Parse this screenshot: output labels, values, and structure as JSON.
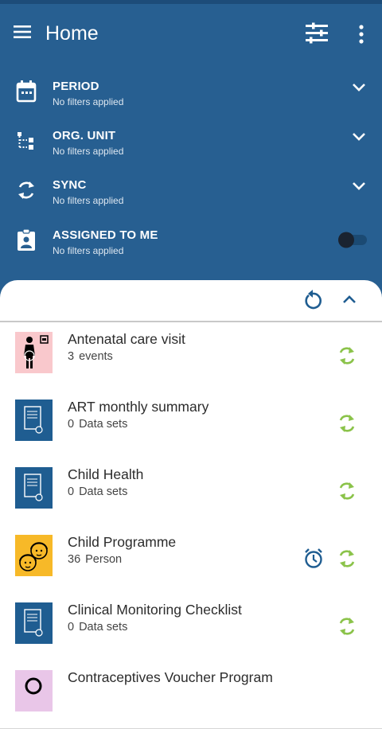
{
  "appbar": {
    "title": "Home",
    "menu_icon": "hamburger-icon",
    "filter_icon": "filter-list-icon",
    "more_icon": "more-vert-icon"
  },
  "filters": [
    {
      "icon": "calendar-icon",
      "label": "PERIOD",
      "sub": "No filters applied",
      "control": "chevron-down-icon"
    },
    {
      "icon": "org-tree-icon",
      "label": "ORG. UNIT",
      "sub": "No filters applied",
      "control": "chevron-down-icon"
    },
    {
      "icon": "sync-icon",
      "label": "SYNC",
      "sub": "No filters applied",
      "control": "chevron-down-icon"
    },
    {
      "icon": "assignment-ind-icon",
      "label": "ASSIGNED TO ME",
      "sub": "No filters applied",
      "control": "toggle",
      "toggle_on": false
    }
  ],
  "sheet": {
    "refresh_icon": "refresh-icon",
    "collapse_icon": "chevron-up-icon"
  },
  "programs": [
    {
      "name": "Antenatal care visit",
      "count": "3",
      "unit": "events",
      "icon": "pregnant-woman-icon",
      "icon_bg": "#f9c8cc",
      "alarm": false
    },
    {
      "name": "ART monthly summary",
      "count": "0",
      "unit": "Data sets",
      "icon": "dataset-form-icon",
      "icon_bg": "#1f5d91",
      "alarm": false
    },
    {
      "name": "Child Health",
      "count": "0",
      "unit": "Data sets",
      "icon": "dataset-form-icon",
      "icon_bg": "#1f5d91",
      "alarm": false
    },
    {
      "name": "Child Programme",
      "count": "36",
      "unit": "Person",
      "icon": "children-faces-icon",
      "icon_bg": "#f7b928",
      "alarm": true
    },
    {
      "name": "Clinical Monitoring Checklist",
      "count": "0",
      "unit": "Data sets",
      "icon": "dataset-form-icon",
      "icon_bg": "#1f5d91",
      "alarm": false
    },
    {
      "name": "Contraceptives Voucher Program",
      "count": "",
      "unit": "",
      "icon": "contraceptive-icon",
      "icon_bg": "#e9c6e8",
      "alarm": false
    }
  ],
  "colors": {
    "header": "#275f91",
    "sync_green": "#8bc34a",
    "alarm_blue": "#1f5d91"
  }
}
